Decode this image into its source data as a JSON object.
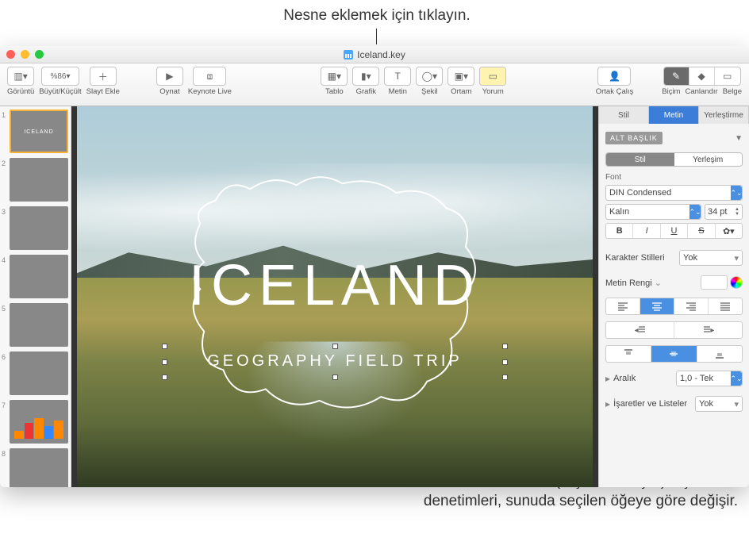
{
  "annotations": {
    "top": "Nesne eklemek için tıklayın.",
    "bottom": "Bu bölümdeki (Biçim denetçisi) biçimleme denetimleri, sunuda seçilen öğeye göre değişir."
  },
  "window": {
    "title": "Iceland.key"
  },
  "toolbar": {
    "view": "Görüntü",
    "zoom_value": "%86",
    "zoom": "Büyüt/Küçült",
    "add_slide": "Slayt Ekle",
    "play": "Oynat",
    "keynote_live": "Keynote Live",
    "table": "Tablo",
    "chart": "Grafik",
    "text": "Metin",
    "shape": "Şekil",
    "media": "Ortam",
    "comment": "Yorum",
    "collaborate": "Ortak Çalış",
    "format": "Biçim",
    "animate": "Canlandır",
    "document": "Belge"
  },
  "slides": [
    {
      "num": "1",
      "selected": true
    },
    {
      "num": "2"
    },
    {
      "num": "3"
    },
    {
      "num": "4"
    },
    {
      "num": "5"
    },
    {
      "num": "6"
    },
    {
      "num": "7"
    },
    {
      "num": "8"
    }
  ],
  "slide": {
    "title": "ICELAND",
    "subtitle": "GEOGRAPHY FIELD TRIP"
  },
  "inspector": {
    "tabs": {
      "style": "Stil",
      "text": "Metin",
      "arrange": "Yerleştirme"
    },
    "paragraph_style": "ALT BAŞLIK",
    "subtabs": {
      "style": "Stil",
      "layout": "Yerleşim"
    },
    "font_label": "Font",
    "font_family": "DIN Condensed",
    "font_weight": "Kalın",
    "font_size": "34 pt",
    "char_styles_label": "Karakter Stilleri",
    "char_styles_value": "Yok",
    "text_color_label": "Metin Rengi",
    "spacing_label": "Aralık",
    "spacing_value": "1,0 - Tek",
    "bullets_label": "İşaretler ve Listeler",
    "bullets_value": "Yok"
  }
}
